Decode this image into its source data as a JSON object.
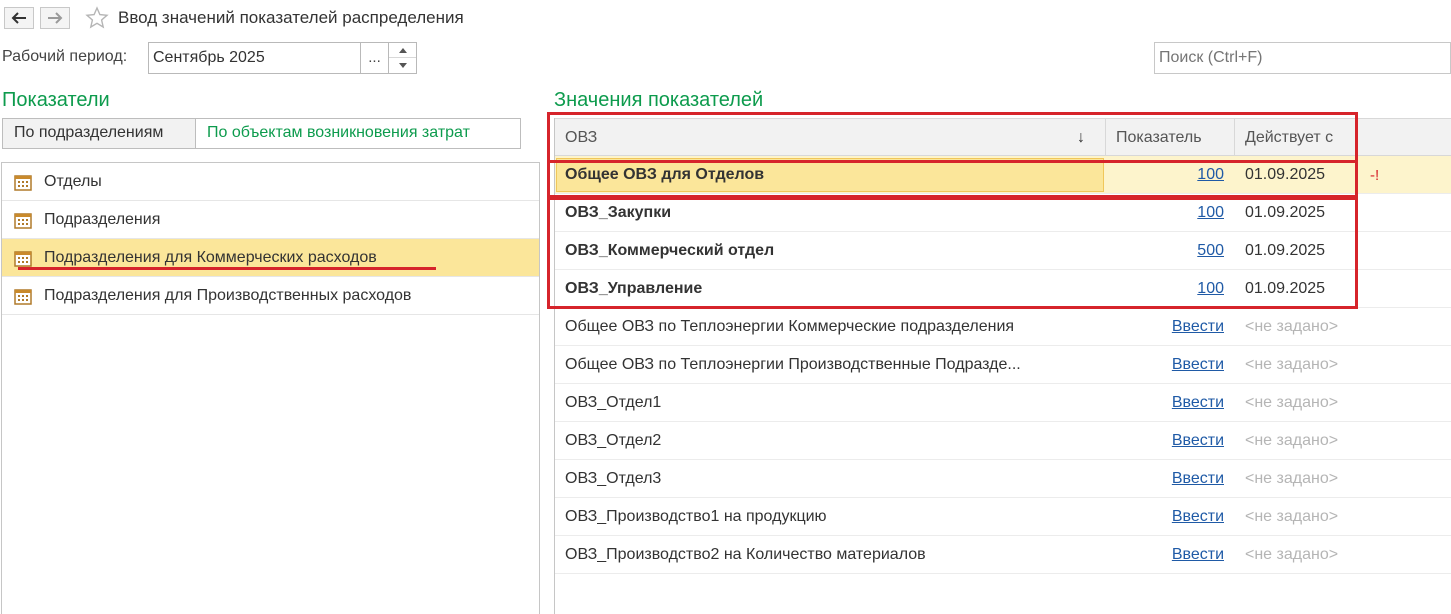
{
  "window": {
    "title": "Ввод значений показателей распределения"
  },
  "period": {
    "label": "Рабочий период:",
    "value": "Сентябрь 2025",
    "select_label": "..."
  },
  "search": {
    "placeholder": "Поиск (Ctrl+F)"
  },
  "indicators": {
    "title": "Показатели",
    "tabs": [
      {
        "label": "По подразделениям",
        "active": false
      },
      {
        "label": "По объектам возникновения затрат",
        "active": true
      }
    ],
    "items": [
      {
        "label": "Отделы",
        "selected": false
      },
      {
        "label": "Подразделения",
        "selected": false
      },
      {
        "label": "Подразделения для Коммерческих расходов",
        "selected": true
      },
      {
        "label": "Подразделения для Производственных расходов",
        "selected": false
      }
    ]
  },
  "values": {
    "title": "Значения показателей",
    "columns": {
      "ovz": "ОВЗ",
      "indicator": "Показатель",
      "effective": "Действует с",
      "sort_glyph": "↓"
    },
    "rows": [
      {
        "name": "Общее ОВЗ для Отделов",
        "value": "100",
        "date": "01.09.2025",
        "bold": true,
        "warn": "-!"
      },
      {
        "name": "ОВЗ_Закупки",
        "value": "100",
        "date": "01.09.2025",
        "bold": true
      },
      {
        "name": "ОВЗ_Коммерческий отдел",
        "value": "500",
        "date": "01.09.2025",
        "bold": true
      },
      {
        "name": "ОВЗ_Управление",
        "value": "100",
        "date": "01.09.2025",
        "bold": true
      },
      {
        "name": "Общее ОВЗ по Теплоэнергии Коммерческие подразделения",
        "value": "Ввести",
        "date": "<не задано>",
        "bold": false
      },
      {
        "name": "Общее ОВЗ по Теплоэнергии Производственные Подразде...",
        "value": "Ввести",
        "date": "<не задано>",
        "bold": false
      },
      {
        "name": "ОВЗ_Отдел1",
        "value": "Ввести",
        "date": "<не задано>",
        "bold": false
      },
      {
        "name": "ОВЗ_Отдел2",
        "value": "Ввести",
        "date": "<не задано>",
        "bold": false
      },
      {
        "name": "ОВЗ_Отдел3",
        "value": "Ввести",
        "date": "<не задано>",
        "bold": false
      },
      {
        "name": "ОВЗ_Производство1 на продукцию",
        "value": "Ввести",
        "date": "<не задано>",
        "bold": false
      },
      {
        "name": "ОВЗ_Производство2 на Количество материалов",
        "value": "Ввести",
        "date": "<не задано>",
        "bold": false
      }
    ]
  },
  "colors": {
    "accent_green": "#0d9b4d",
    "selection_yellow": "#fbe69a",
    "annotation_red": "#d6242b",
    "link_blue": "#1f5aa6"
  },
  "icons": {
    "back": "arrow-left-icon",
    "forward": "arrow-right-icon",
    "favorite": "star-icon",
    "list_item": "calendar-icon"
  }
}
